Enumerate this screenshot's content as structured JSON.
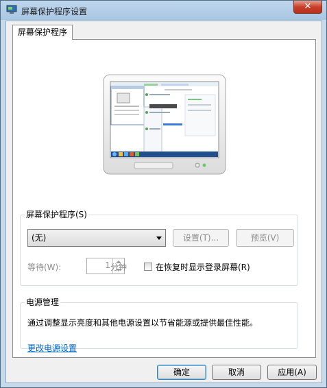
{
  "window": {
    "title": "屏幕保护程序设置",
    "close_glyph": "✕"
  },
  "tab": {
    "label": "屏幕保护程序"
  },
  "screensaver": {
    "group_label": "屏幕保护程序(S)",
    "selected": "(无)",
    "settings_label": "设置(T)...",
    "preview_label": "预览(V)",
    "wait_label": "等待(W):",
    "wait_value": "1",
    "wait_unit": "分钟",
    "resume_label": "在恢复时显示登录屏幕(R)",
    "resume_checked": false
  },
  "power": {
    "group_label": "电源管理",
    "description": "通过调整显示亮度和其他电源设置以节省能源或提供最佳性能。",
    "link": "更改电源设置"
  },
  "footer": {
    "ok_label": "确定",
    "cancel_label": "取消",
    "apply_label": "应用(A)"
  },
  "colors": {
    "accent": "#0066cc",
    "frame": "#c7daec",
    "close": "#c9412b"
  }
}
